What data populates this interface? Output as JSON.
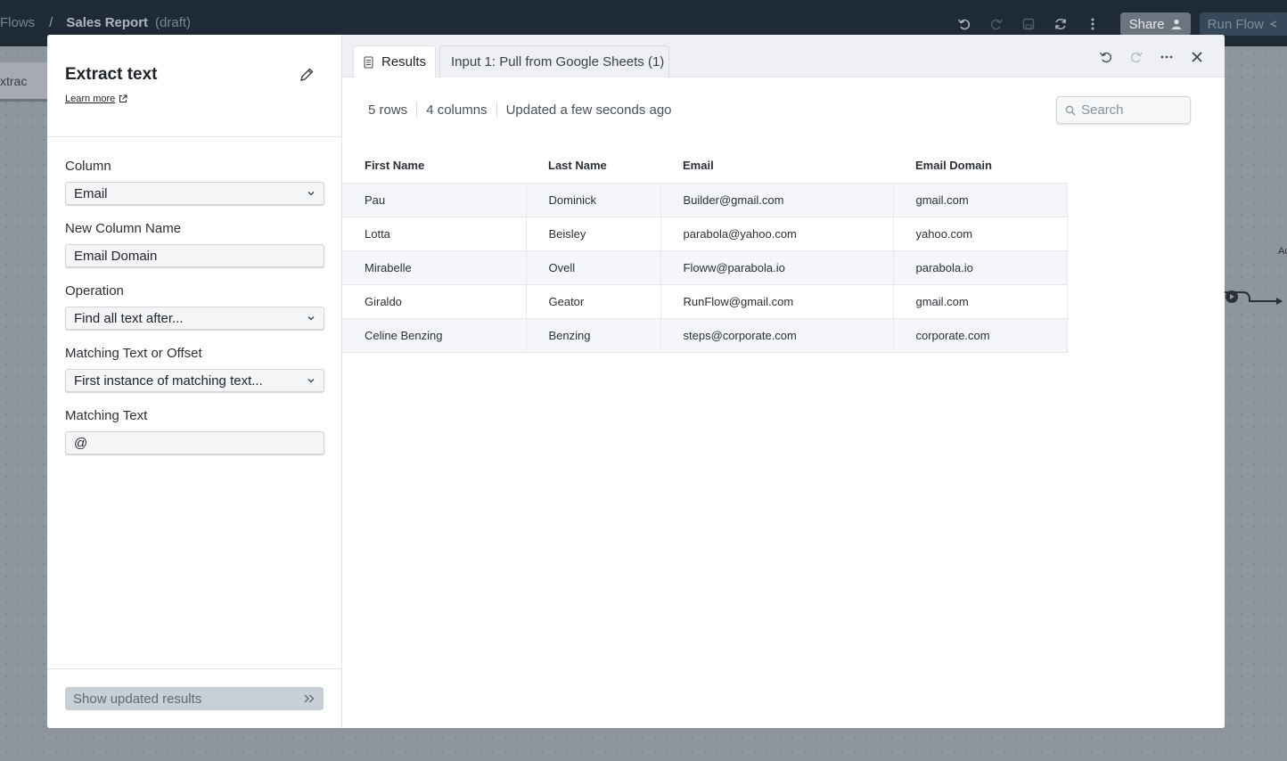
{
  "topbar": {
    "breadcrumb_root": "Flows",
    "breadcrumb_sep": "/",
    "flow_name": "Sales Report",
    "flow_status": "(draft)",
    "share_label": "Share",
    "run_label": "Run Flow"
  },
  "background": {
    "tab_label": "xtrac",
    "node_label": "Ac"
  },
  "left_panel": {
    "title": "Extract text",
    "learn_more": "Learn more",
    "fields": [
      {
        "label": "Column",
        "value": "Email",
        "type": "select"
      },
      {
        "label": "New Column Name",
        "value": "Email Domain",
        "type": "input"
      },
      {
        "label": "Operation",
        "value": "Find all text after...",
        "type": "select"
      },
      {
        "label": "Matching Text or Offset",
        "value": "First instance of matching text...",
        "type": "select"
      },
      {
        "label": "Matching Text",
        "value": "@",
        "type": "input"
      }
    ],
    "show_results_label": "Show updated results"
  },
  "right_panel": {
    "tabs": [
      {
        "label": "Results",
        "active": true
      },
      {
        "label": "Input 1: Pull from Google Sheets (1)",
        "active": false
      }
    ],
    "stats": {
      "rows": "5 rows",
      "columns": "4 columns",
      "updated": "Updated a few seconds ago"
    },
    "search_placeholder": "Search",
    "table": {
      "headers": [
        "First Name",
        "Last Name",
        "Email",
        "Email Domain"
      ],
      "rows": [
        [
          "Pau",
          "Dominick",
          "Builder@gmail.com",
          "gmail.com"
        ],
        [
          "Lotta",
          "Beisley",
          "parabola@yahoo.com",
          "yahoo.com"
        ],
        [
          "Mirabelle",
          "Ovell",
          "Floww@parabola.io",
          "parabola.io"
        ],
        [
          "Giraldo",
          "Geator",
          "RunFlow@gmail.com",
          "gmail.com"
        ],
        [
          "Celine Benzing",
          "Benzing",
          "steps@corporate.com",
          "corporate.com"
        ]
      ]
    }
  },
  "colors": {
    "topbar_bg": "#1e2a36",
    "modal_bg": "#ffffff",
    "row_alt_bg": "#f4f6f9",
    "button_disabled_bg": "#c8cfd6"
  }
}
